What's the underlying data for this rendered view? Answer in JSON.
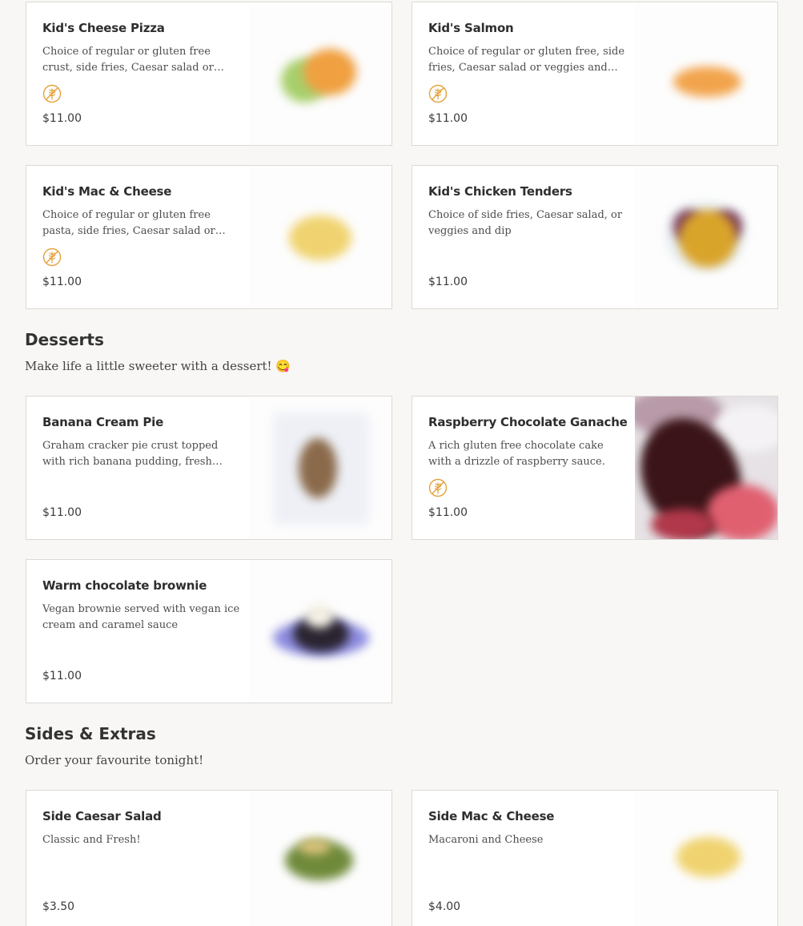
{
  "kids": {
    "items": [
      {
        "name": "Kid's Cheese Pizza",
        "description": "Choice of regular or gluten free crust, side fries, Caesar salad or veggies and dip",
        "gluten_free_icon": "gluten-free-icon",
        "price": "$11.00"
      },
      {
        "name": "Kid's Salmon",
        "description": "Choice of regular or gluten free, side fries, Caesar salad or veggies and dip",
        "gluten_free_icon": "gluten-free-icon",
        "price": "$11.00"
      },
      {
        "name": "Kid's Mac & Cheese",
        "description": "Choice of regular or gluten free pasta, side fries, Caesar salad or veggies and dip",
        "gluten_free_icon": "gluten-free-icon",
        "price": "$11.00"
      },
      {
        "name": "Kid's Chicken Tenders",
        "description": "Choice of side fries, Caesar salad, or veggies and dip",
        "price": "$11.00"
      }
    ]
  },
  "desserts": {
    "title": "Desserts",
    "subtitle": "Make life a little sweeter with a dessert! 😋",
    "items": [
      {
        "name": "Banana Cream Pie",
        "description": "Graham cracker pie crust topped with rich banana pudding, fresh bananas and whipped cream",
        "price": "$11.00"
      },
      {
        "name": "Raspberry Chocolate Ganache",
        "description": "A rich gluten free chocolate cake with a drizzle of raspberry sauce.",
        "gluten_free_icon": "gluten-free-icon",
        "price": "$11.00"
      },
      {
        "name": "Warm chocolate brownie",
        "description": "Vegan brownie served with vegan ice cream and caramel sauce",
        "price": "$11.00"
      }
    ]
  },
  "sides": {
    "title": "Sides & Extras",
    "subtitle": "Order your favourite tonight!",
    "items": [
      {
        "name": "Side Caesar Salad",
        "description": "Classic and Fresh!",
        "price": "$3.50"
      },
      {
        "name": "Side Mac & Cheese",
        "description": "Macaroni and Cheese",
        "price": "$4.00"
      }
    ]
  },
  "colors": {
    "page_background": "#f8f7f5",
    "card_border": "#dcdad6",
    "gluten_free_icon": "#e2a23c"
  }
}
